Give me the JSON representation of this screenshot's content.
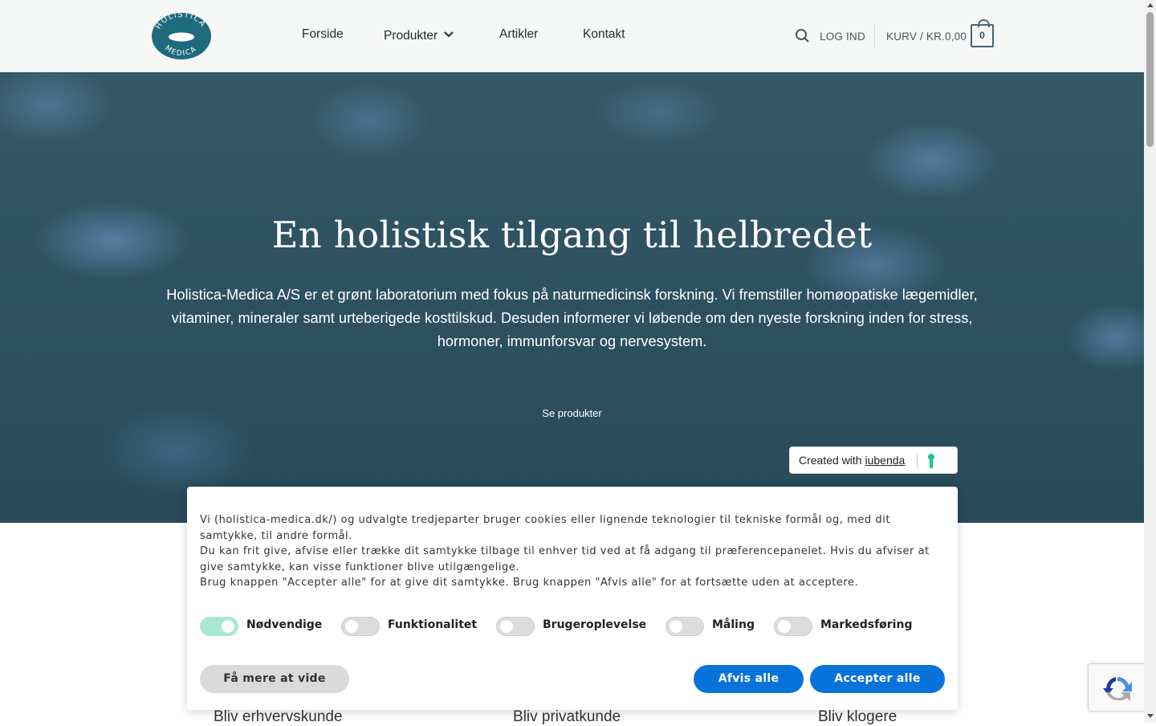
{
  "header": {
    "logo_text_top": "HOLISTICA",
    "logo_text_bottom": "MEDICA",
    "nav": [
      {
        "label": "Forside"
      },
      {
        "label": "Produkter"
      },
      {
        "label": "Artikler"
      },
      {
        "label": "Kontakt"
      }
    ],
    "login_label": "LOG IND",
    "cart_label": "KURV / KR.0,00",
    "cart_count": "0",
    "icons": [
      "search-icon",
      "chevron-down-icon",
      "cart-icon"
    ]
  },
  "hero": {
    "title": "En holistisk tilgang til helbredet",
    "text": "Holistica-Medica A/S er et grønt laboratorium med fokus på naturmedicinsk forskning. Vi fremstiller homøopatiske lægemidler, vitaminer, mineraler samt urteberigede kosttilskud. Desuden informerer vi løbende om den nyeste forskning inden for stress, hormoner, immunforsvar og nervesystem.",
    "cta": "Se produkter"
  },
  "cards": [
    "Bliv erhvervskunde",
    "Bliv privatkunde",
    "Bliv klogere"
  ],
  "iubenda": {
    "prefix": "Created with ",
    "link": "iubenda"
  },
  "cookie": {
    "line1": "Vi (holistica-medica.dk/) og udvalgte tredjeparter bruger cookies eller lignende teknologier til tekniske formål og, med dit samtykke, til andre formål.",
    "line2": "Du kan frit give, afvise eller trække dit samtykke tilbage til enhver tid ved at få adgang til præferencepanelet. Hvis du afviser at give samtykke, kan visse funktioner blive utilgængelige.",
    "line3": "Brug knappen \"Accepter alle\" for at give dit samtykke. Brug knappen \"Afvis alle\" for at fortsætte uden at acceptere.",
    "toggles": [
      {
        "label": "Nødvendige",
        "on": true
      },
      {
        "label": "Funktionalitet",
        "on": false
      },
      {
        "label": "Brugeroplevelse",
        "on": false
      },
      {
        "label": "Måling",
        "on": false
      },
      {
        "label": "Markedsføring",
        "on": false
      }
    ],
    "learn_more": "Få mere at vide",
    "reject_all": "Afvis alle",
    "accept_all": "Accepter alle"
  },
  "colors": {
    "accent_blue": "#0a73d9",
    "toggle_on": "#a9e6d4",
    "logo_teal": "#1e6a7e"
  }
}
